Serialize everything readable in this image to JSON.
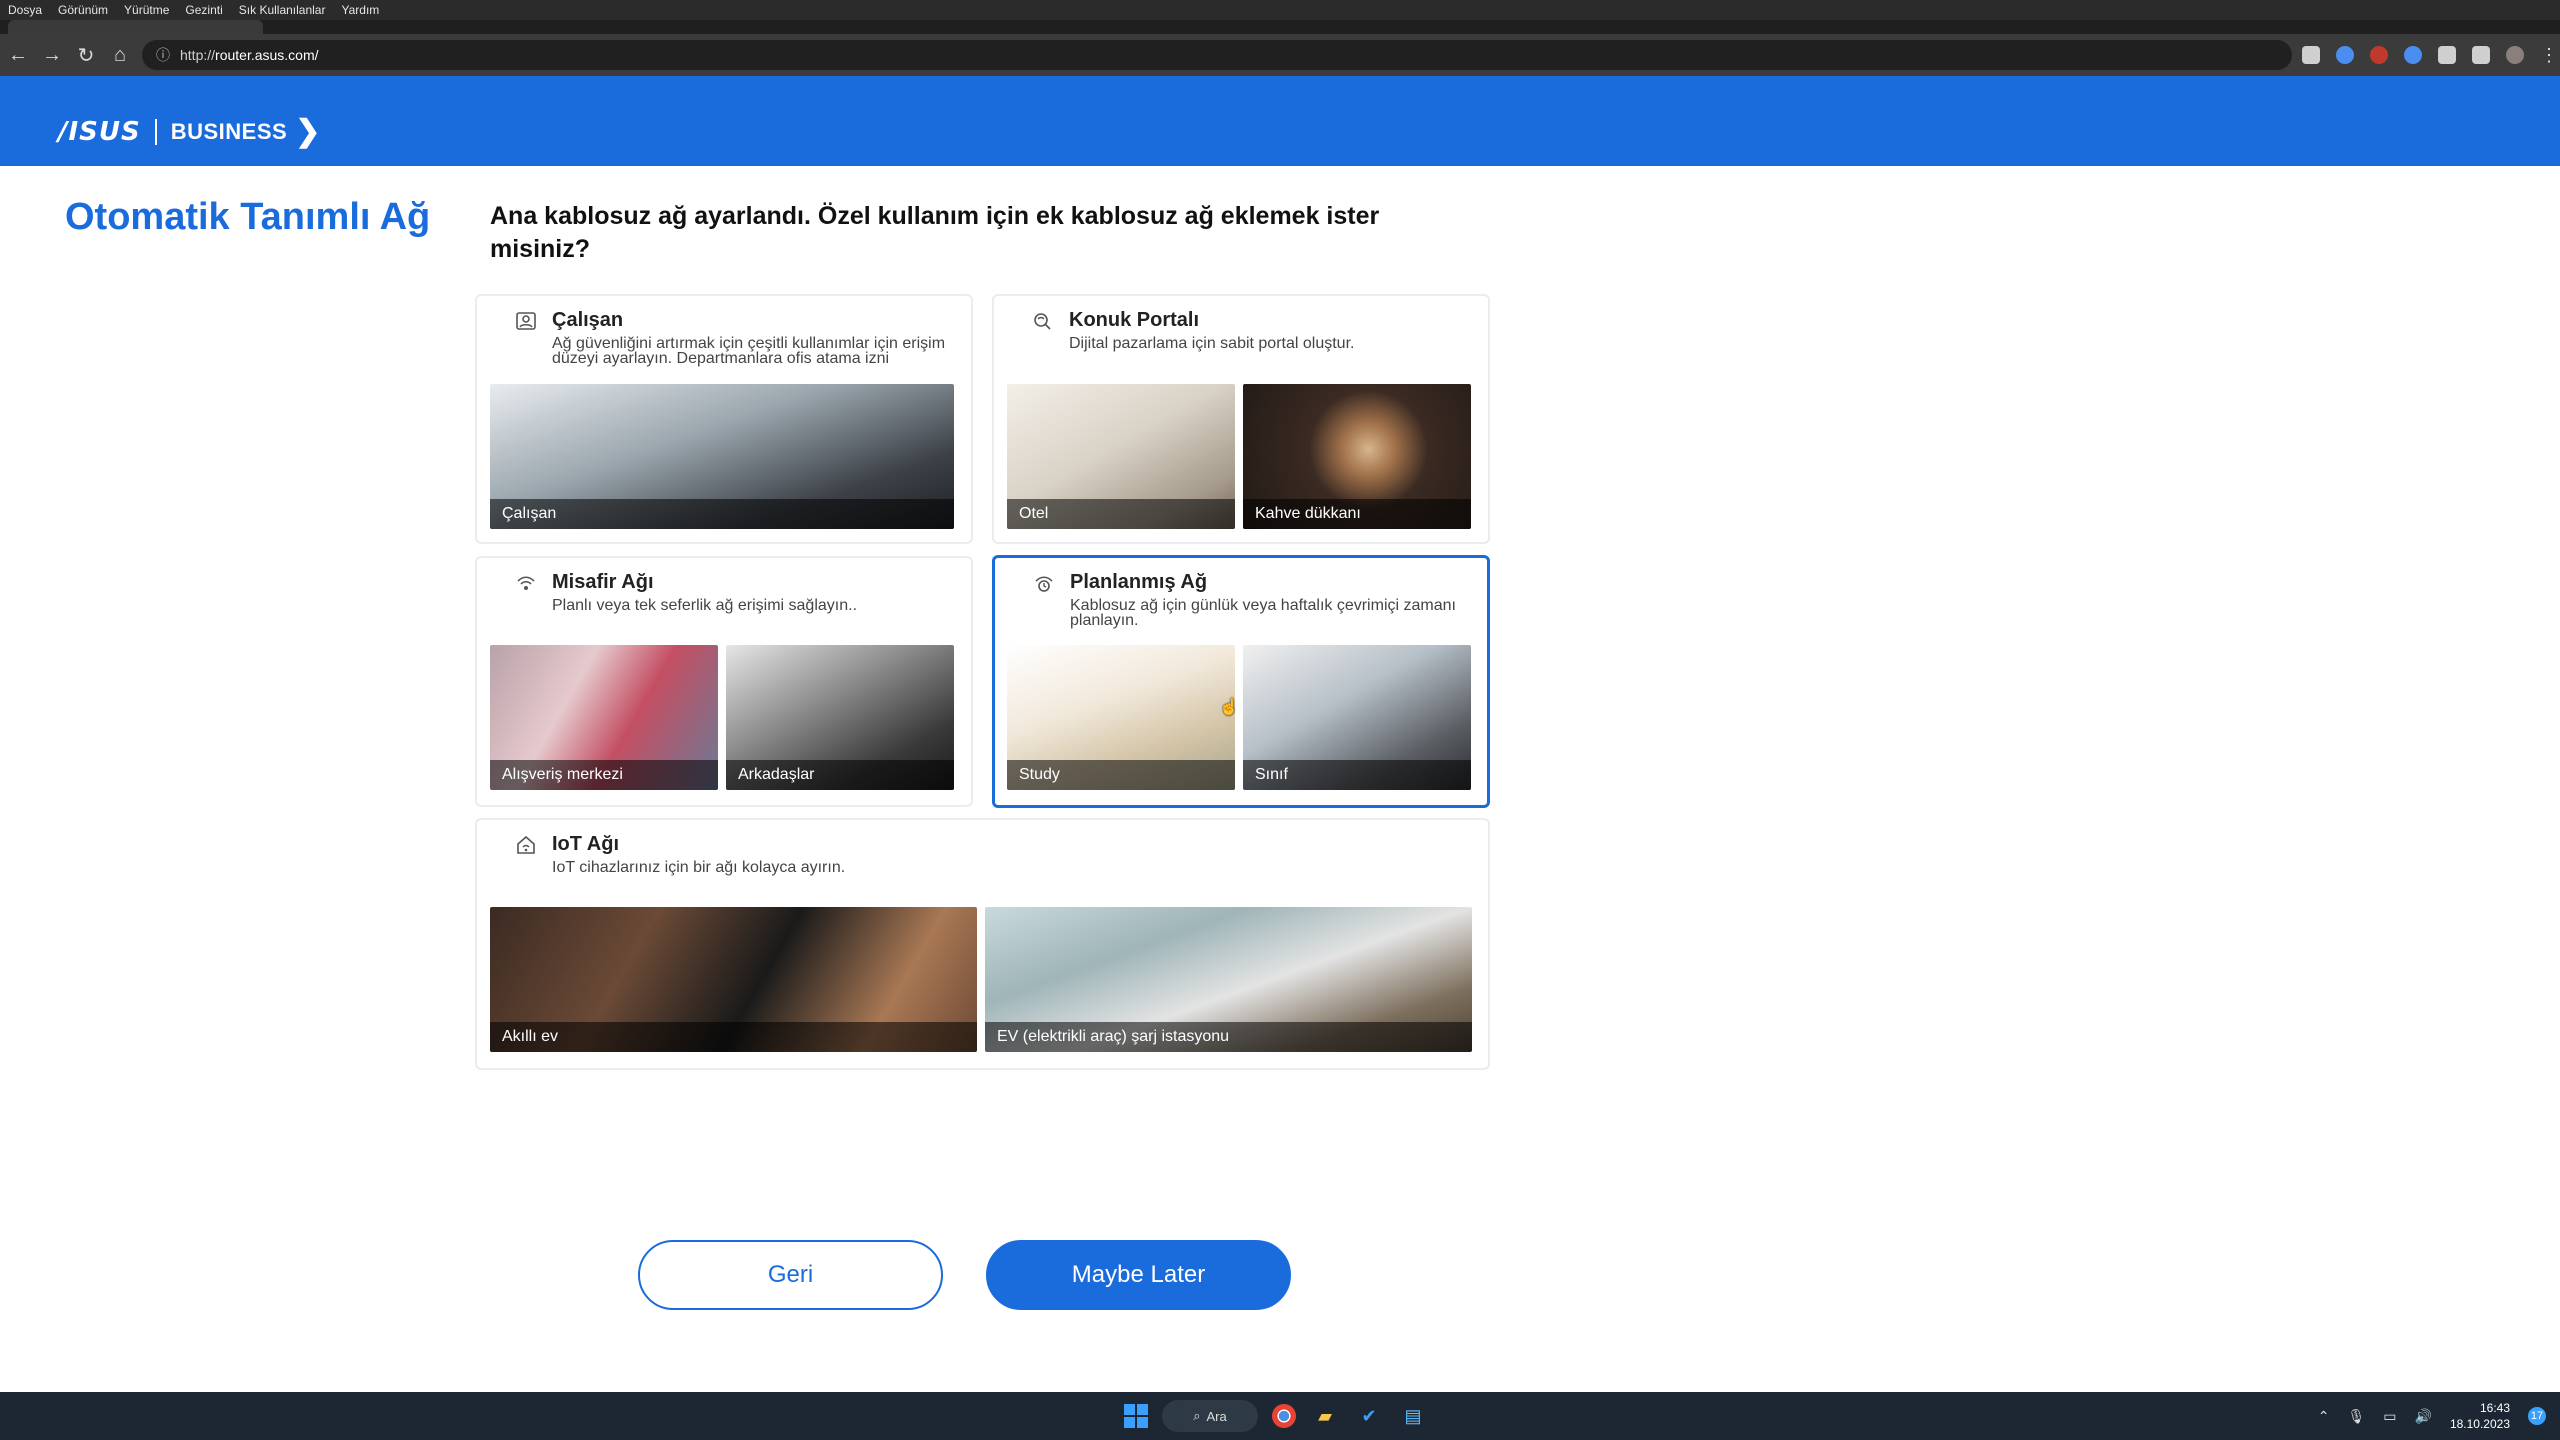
{
  "menu": [
    "Dosya",
    "Görünüm",
    "Yürütme",
    "Gezinti",
    "Sık Kullanılanlar",
    "Yardım"
  ],
  "browser": {
    "url_prefix": "http://",
    "url_host": "router.asus.com/"
  },
  "brand": {
    "asus": "/ISUS",
    "business": "BUSINESS"
  },
  "page": {
    "title": "Otomatik Tanımlı Ağ",
    "question": "Ana kablosuz ağ ayarlandı. Özel kullanım için ek kablosuz ağ eklemek ister misiniz?"
  },
  "cards": {
    "employee": {
      "title": "Çalışan",
      "desc": "Ağ güvenliğini artırmak için çeşitli kullanımlar için erişim düzeyi ayarlayın. Departmanlara ofis atama izni",
      "images": [
        "Çalışan"
      ]
    },
    "portal": {
      "title": "Konuk Portalı",
      "desc": "Dijital pazarlama için sabit portal oluştur.",
      "images": [
        "Otel",
        "Kahve dükkanı"
      ]
    },
    "guest": {
      "title": "Misafir Ağı",
      "desc": "Planlı veya tek seferlik ağ erişimi sağlayın..",
      "images": [
        "Alışveriş merkezi",
        "Arkadaşlar"
      ]
    },
    "scheduled": {
      "title": "Planlanmış Ağ",
      "desc": "Kablosuz ağ için günlük veya haftalık çevrimiçi zamanı planlayın.",
      "images": [
        "Study",
        "Sınıf"
      ]
    },
    "iot": {
      "title": "IoT Ağı",
      "desc": "IoT cihazlarınız için bir ağı kolayca ayırın.",
      "images": [
        "Akıllı ev",
        "EV (elektrikli araç) şarj istasyonu"
      ]
    }
  },
  "buttons": {
    "back": "Geri",
    "later": "Maybe Later"
  },
  "taskbar": {
    "search": "Ara",
    "time": "16:43",
    "date": "18.10.2023",
    "notifications": "17"
  },
  "colors": {
    "brand_blue": "#1a6bdc",
    "taskbar": "#1c2733"
  }
}
